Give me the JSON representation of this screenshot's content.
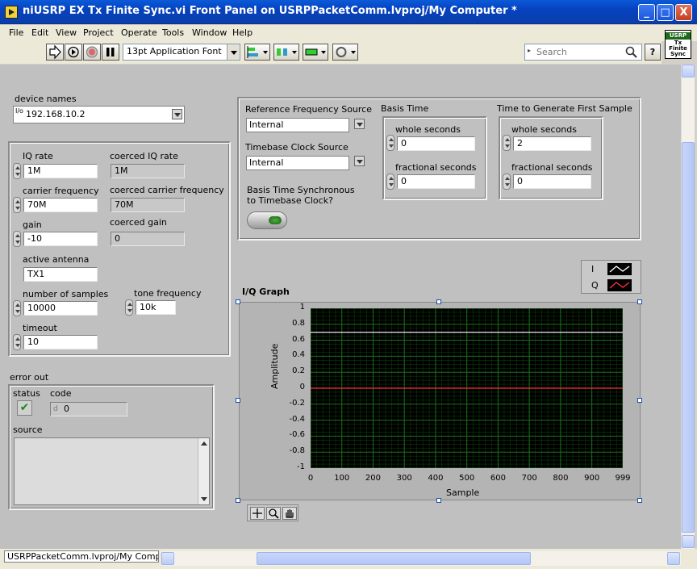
{
  "window": {
    "title": "niUSRP EX Tx Finite Sync.vi Front Panel on USRPPacketComm.lvproj/My Computer *",
    "min_label": "_",
    "max_label": "□",
    "close_label": "X"
  },
  "menu": [
    "File",
    "Edit",
    "View",
    "Project",
    "Operate",
    "Tools",
    "Window",
    "Help"
  ],
  "toolbar": {
    "font_label": "13pt Application Font",
    "search_placeholder": "Search",
    "help_label": "?",
    "vi_icon_lines": [
      "USRP",
      "Tx",
      "Finite",
      "Sync"
    ]
  },
  "device": {
    "label": "device names",
    "io_prefix": "I/o",
    "value": "192.168.10.2"
  },
  "params": {
    "iq_rate_label": "IQ rate",
    "iq_rate": "1M",
    "coerced_iq_rate_label": "coerced IQ rate",
    "coerced_iq_rate": "1M",
    "carrier_label": "carrier frequency",
    "carrier": "70M",
    "coerced_carrier_label": "coerced carrier frequency",
    "coerced_carrier": "70M",
    "gain_label": "gain",
    "gain": "-10",
    "coerced_gain_label": "coerced gain",
    "coerced_gain": "0",
    "antenna_label": "active antenna",
    "antenna": "TX1",
    "samples_label": "number of samples",
    "samples": "10000",
    "tone_label": "tone frequency",
    "tone": "10k",
    "timeout_label": "timeout",
    "timeout": "10"
  },
  "error_out": {
    "label": "error out",
    "status_label": "status",
    "code_label": "code",
    "code_prefix": "d",
    "code": "0",
    "source_label": "source",
    "status_check": "✔"
  },
  "sync": {
    "ref_freq_label": "Reference Frequency Source",
    "ref_freq": "Internal",
    "timebase_label": "Timebase Clock Source",
    "timebase": "Internal",
    "basis_sync_label_1": "Basis Time Synchronous",
    "basis_sync_label_2": "to Timebase Clock?",
    "basis_time_label": "Basis Time",
    "basis_whole_label": "whole seconds",
    "basis_whole": "0",
    "basis_frac_label": "fractional seconds",
    "basis_frac": "0",
    "first_sample_label": "Time to Generate First Sample",
    "first_whole_label": "whole seconds",
    "first_whole": "2",
    "first_frac_label": "fractional seconds",
    "first_frac": "0"
  },
  "graph": {
    "title": "I/Q Graph",
    "legend": [
      {
        "name": "I",
        "color": "#ffffff"
      },
      {
        "name": "Q",
        "color": "#ff3030"
      }
    ]
  },
  "chart_data": {
    "type": "line",
    "title": "I/Q Graph",
    "xlabel": "Sample",
    "ylabel": "Amplitude",
    "xlim": [
      0,
      999
    ],
    "ylim": [
      -1,
      1
    ],
    "x_ticks": [
      0,
      100,
      200,
      300,
      400,
      500,
      600,
      700,
      800,
      900,
      999
    ],
    "y_ticks": [
      1,
      0.8,
      0.6,
      0.4,
      0.2,
      0,
      -0.2,
      -0.4,
      -0.6,
      -0.8,
      -1
    ],
    "y_tick_labels": [
      "1",
      "0.8",
      "0.6",
      "0.4",
      "0.2",
      "0",
      "-0.2",
      "-0.4",
      "-0.6",
      "-0.8",
      "-1"
    ],
    "grid": true,
    "legend_position": "top-right",
    "background": "#000000",
    "grid_color": "#1a6e1a",
    "series": [
      {
        "name": "I",
        "color": "#ffffff",
        "x": [
          0,
          999
        ],
        "y": [
          0.7,
          0.7
        ]
      },
      {
        "name": "Q",
        "color": "#ff3030",
        "x": [
          0,
          999
        ],
        "y": [
          0,
          0
        ]
      }
    ]
  },
  "status_bar": {
    "path": "USRPPacketComm.lvproj/My Computer"
  }
}
